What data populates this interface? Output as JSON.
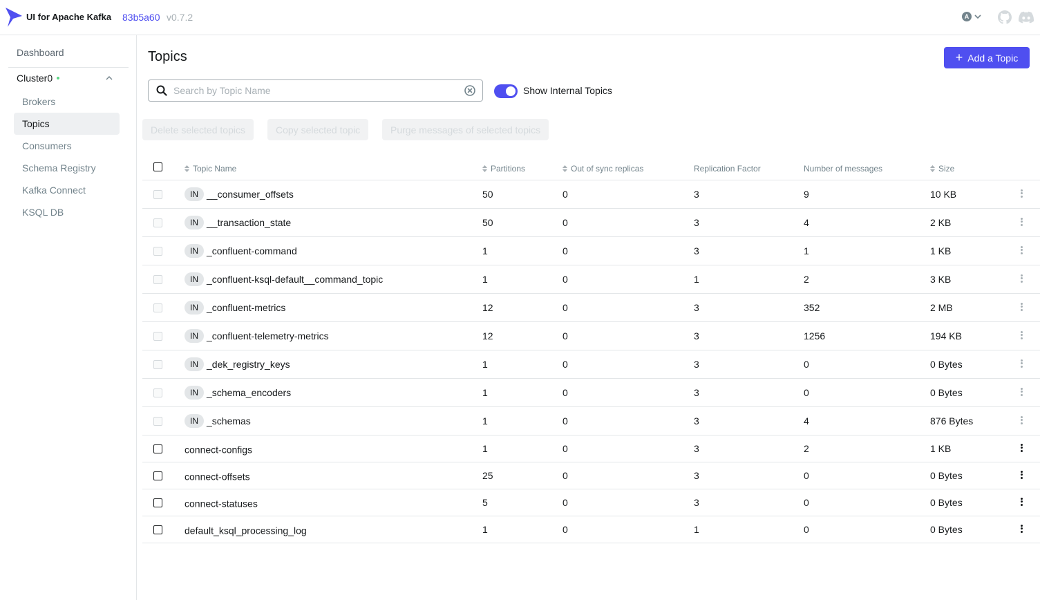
{
  "header": {
    "app_title": "UI for Apache Kafka",
    "commit": "83b5a60",
    "version": "v0.7.2",
    "user_initial": "A"
  },
  "sidebar": {
    "dashboard": "Dashboard",
    "cluster_name": "Cluster0",
    "items": [
      {
        "label": "Brokers",
        "active": false
      },
      {
        "label": "Topics",
        "active": true
      },
      {
        "label": "Consumers",
        "active": false
      },
      {
        "label": "Schema Registry",
        "active": false
      },
      {
        "label": "Kafka Connect",
        "active": false
      },
      {
        "label": "KSQL DB",
        "active": false
      }
    ]
  },
  "main": {
    "title": "Topics",
    "add_button": "Add a Topic",
    "search_placeholder": "Search by Topic Name",
    "toggle_label": "Show Internal Topics",
    "batch_actions": [
      "Delete selected topics",
      "Copy selected topic",
      "Purge messages of selected topics"
    ]
  },
  "table": {
    "columns": {
      "name": "Topic Name",
      "partitions": "Partitions",
      "out_of_sync": "Out of sync replicas",
      "replication": "Replication Factor",
      "messages": "Number of messages",
      "size": "Size"
    },
    "internal_badge": "IN",
    "rows": [
      {
        "name": "__consumer_offsets",
        "internal": true,
        "partitions": "50",
        "out_of_sync": "0",
        "replication": "3",
        "messages": "9",
        "size": "10 KB"
      },
      {
        "name": "__transaction_state",
        "internal": true,
        "partitions": "50",
        "out_of_sync": "0",
        "replication": "3",
        "messages": "4",
        "size": "2 KB"
      },
      {
        "name": "_confluent-command",
        "internal": true,
        "partitions": "1",
        "out_of_sync": "0",
        "replication": "3",
        "messages": "1",
        "size": "1 KB"
      },
      {
        "name": "_confluent-ksql-default__command_topic",
        "internal": true,
        "partitions": "1",
        "out_of_sync": "0",
        "replication": "1",
        "messages": "2",
        "size": "3 KB"
      },
      {
        "name": "_confluent-metrics",
        "internal": true,
        "partitions": "12",
        "out_of_sync": "0",
        "replication": "3",
        "messages": "352",
        "size": "2 MB"
      },
      {
        "name": "_confluent-telemetry-metrics",
        "internal": true,
        "partitions": "12",
        "out_of_sync": "0",
        "replication": "3",
        "messages": "1256",
        "size": "194 KB"
      },
      {
        "name": "_dek_registry_keys",
        "internal": true,
        "partitions": "1",
        "out_of_sync": "0",
        "replication": "3",
        "messages": "0",
        "size": "0 Bytes"
      },
      {
        "name": "_schema_encoders",
        "internal": true,
        "partitions": "1",
        "out_of_sync": "0",
        "replication": "3",
        "messages": "0",
        "size": "0 Bytes"
      },
      {
        "name": "_schemas",
        "internal": true,
        "partitions": "1",
        "out_of_sync": "0",
        "replication": "3",
        "messages": "4",
        "size": "876 Bytes"
      },
      {
        "name": "connect-configs",
        "internal": false,
        "partitions": "1",
        "out_of_sync": "0",
        "replication": "3",
        "messages": "2",
        "size": "1 KB"
      },
      {
        "name": "connect-offsets",
        "internal": false,
        "partitions": "25",
        "out_of_sync": "0",
        "replication": "3",
        "messages": "0",
        "size": "0 Bytes"
      },
      {
        "name": "connect-statuses",
        "internal": false,
        "partitions": "5",
        "out_of_sync": "0",
        "replication": "3",
        "messages": "0",
        "size": "0 Bytes"
      },
      {
        "name": "default_ksql_processing_log",
        "internal": false,
        "partitions": "1",
        "out_of_sync": "0",
        "replication": "1",
        "messages": "0",
        "size": "0 Bytes"
      }
    ]
  },
  "colors": {
    "accent": "#4f4ff0",
    "status_online": "#5cd685",
    "border": "#e3e6e8",
    "muted_text": "#73848c"
  }
}
